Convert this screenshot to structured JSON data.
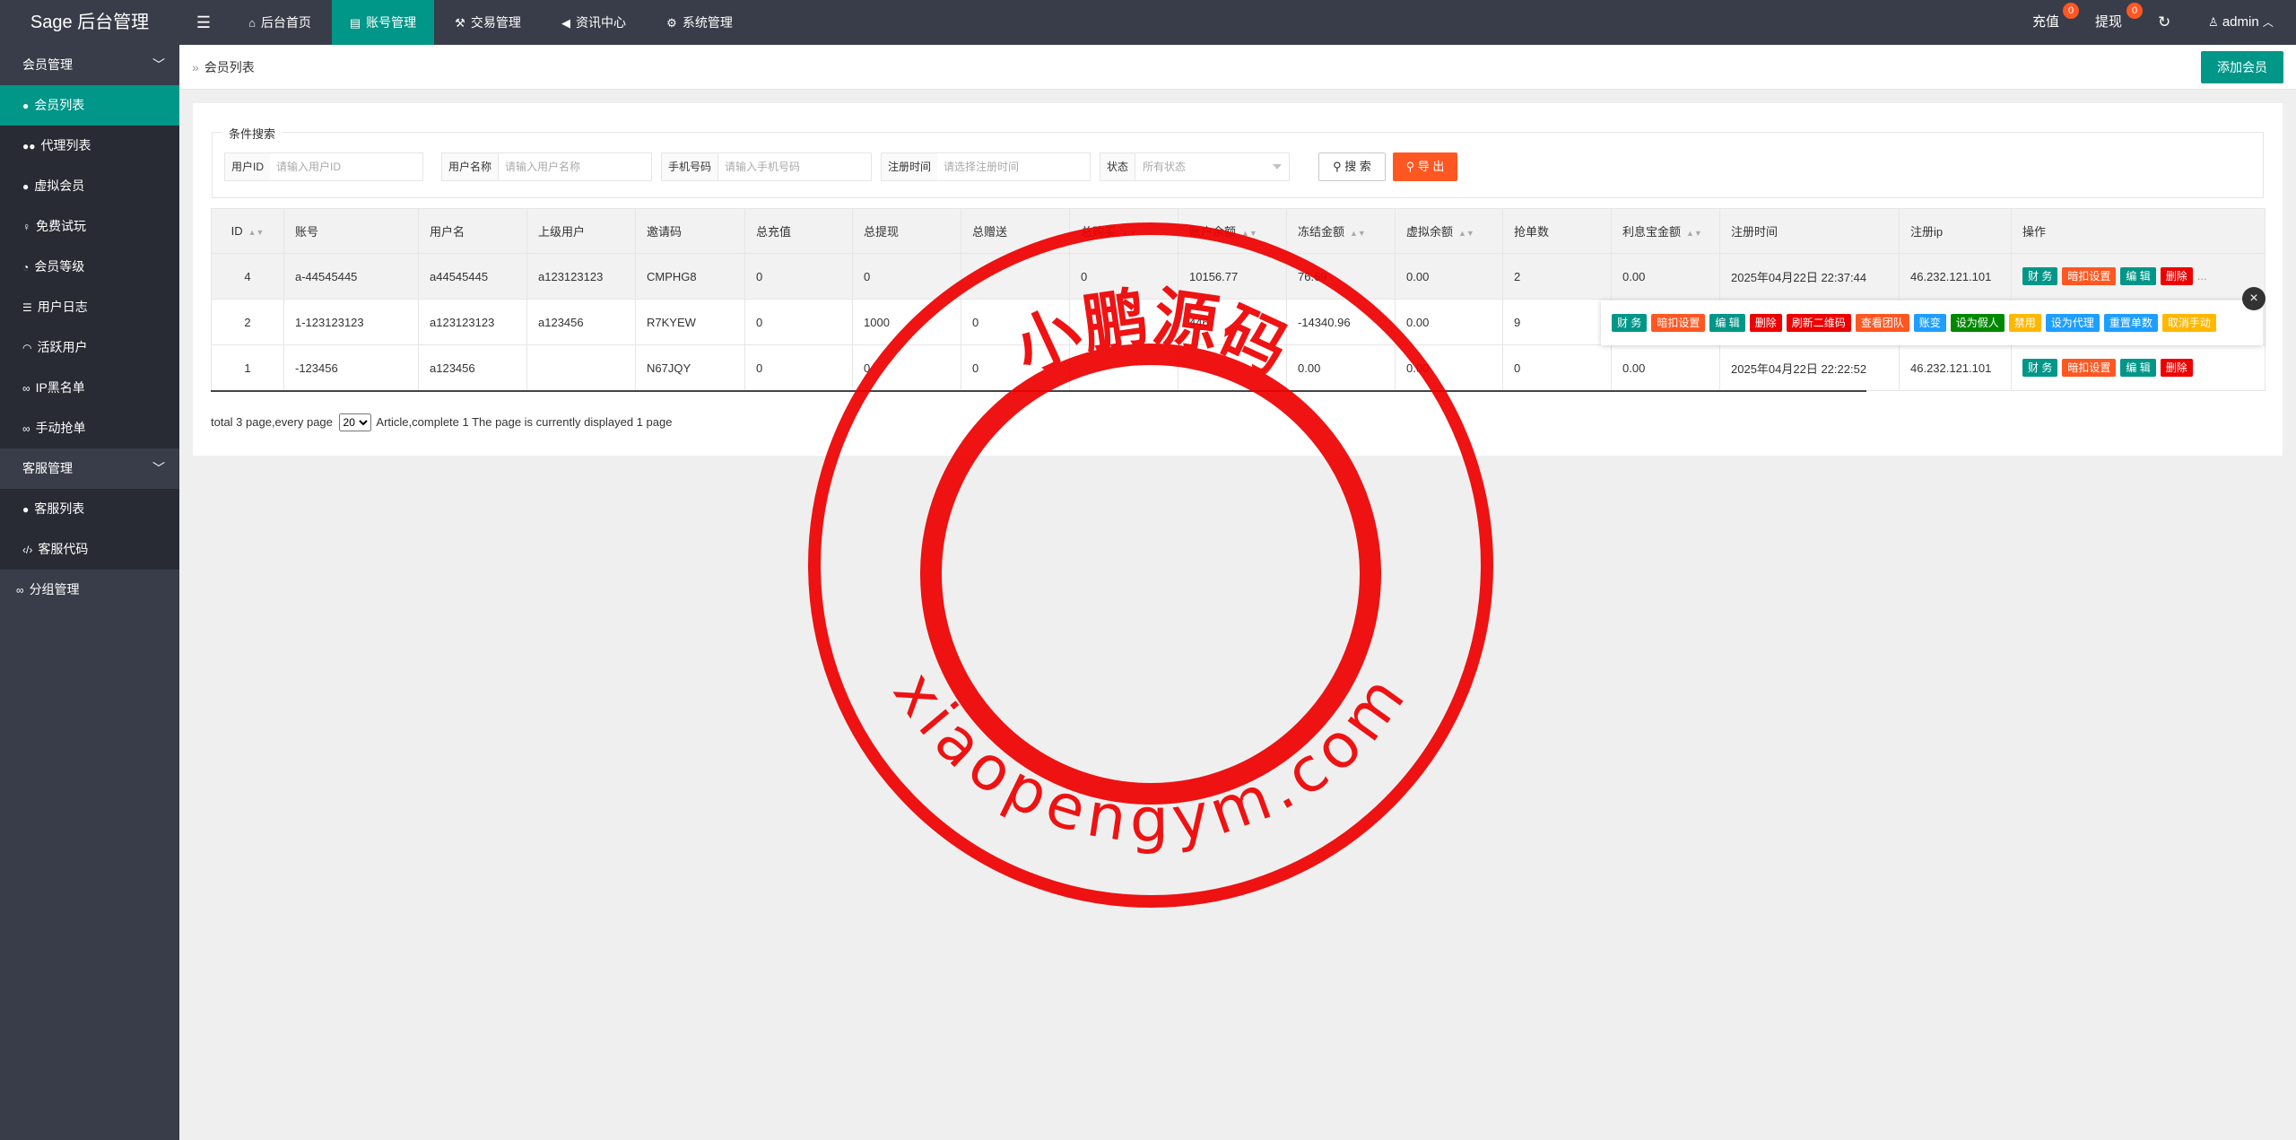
{
  "header": {
    "brand": "Sage 后台管理",
    "nav": [
      {
        "label": "后台首页",
        "icon": "home-icon"
      },
      {
        "label": "账号管理",
        "icon": "id-card-icon"
      },
      {
        "label": "交易管理",
        "icon": "gavel-icon"
      },
      {
        "label": "资讯中心",
        "icon": "bullhorn-icon"
      },
      {
        "label": "系统管理",
        "icon": "gears-icon"
      }
    ],
    "recharge_label": "充值",
    "recharge_count": "0",
    "withdraw_label": "提现",
    "withdraw_count": "0",
    "user": "admin"
  },
  "sidebar": {
    "group1": "会员管理",
    "items1": [
      "会员列表",
      "代理列表",
      "虚拟会员",
      "免费试玩",
      "会员等级",
      "用户日志",
      "活跃用户",
      "IP黑名单",
      "手动抢单"
    ],
    "group2": "客服管理",
    "items2": [
      "客服列表",
      "客服代码"
    ],
    "item3": "分组管理"
  },
  "breadcrumb": "会员列表",
  "add_button": "添加会员",
  "filter": {
    "legend": "条件搜索",
    "fields": [
      {
        "label": "用户ID",
        "placeholder": "请输入用户ID"
      },
      {
        "label": "用户名称",
        "placeholder": "请输入用户名称"
      },
      {
        "label": "手机号码",
        "placeholder": "请输入手机号码"
      },
      {
        "label": "注册时间",
        "placeholder": "请选择注册时间"
      },
      {
        "label": "状态",
        "placeholder": "所有状态"
      }
    ],
    "search": "搜 索",
    "export": "导 出"
  },
  "table": {
    "headers": [
      "ID",
      "账号",
      "用户名",
      "上级用户",
      "邀请码",
      "总充值",
      "总提现",
      "总赠送",
      "总购买",
      "账户余额",
      "冻结金额",
      "虚拟余额",
      "抢单数",
      "利息宝金额",
      "注册时间",
      "注册ip",
      "操作"
    ],
    "rows": [
      {
        "id": "4",
        "account": "a-44545445",
        "username": "a44545445",
        "parent": "a123123123",
        "invite": "CMPHG8",
        "recharge": "0",
        "withdraw": "0",
        "gift": "",
        "buy": "0",
        "balance": "10156.77",
        "frozen": "76.69",
        "virtual": "0.00",
        "orders": "2",
        "interest": "0.00",
        "regtime": "2025年04月22日 22:37:44",
        "ip": "46.232.121.101"
      },
      {
        "id": "2",
        "account": "1-123123123",
        "username": "a123123123",
        "parent": "a123456",
        "invite": "R7KYEW",
        "recharge": "0",
        "withdraw": "1000",
        "gift": "0",
        "buy": "",
        "balance": "446",
        "frozen": "-14340.96",
        "virtual": "0.00",
        "orders": "9",
        "interest": "",
        "regtime": "",
        "ip": ""
      },
      {
        "id": "1",
        "account": "-123456",
        "username": "a123456",
        "parent": "",
        "invite": "N67JQY",
        "recharge": "0",
        "withdraw": "0",
        "gift": "0",
        "buy": "",
        "balance": "",
        "frozen": "0.00",
        "virtual": "0.00",
        "orders": "0",
        "interest": "0.00",
        "regtime": "2025年04月22日 22:22:52",
        "ip": "46.232.121.101"
      }
    ],
    "ops": [
      "财 务",
      "暗扣设置",
      "编 辑",
      "删除"
    ],
    "more": "..."
  },
  "popup_ops": [
    "财 务",
    "暗扣设置",
    "编 辑",
    "删除",
    "刷新二维码",
    "查看团队",
    "账变",
    "设为假人",
    "禁用",
    "设为代理",
    "重置单数",
    "取消手动"
  ],
  "pager": {
    "before": "total 3 page,every page",
    "select": "20",
    "after": "Article,complete 1 The page is currently displayed 1 page"
  },
  "watermark": {
    "top": "小鹏源码",
    "bottom": "xiaopengym.com"
  }
}
